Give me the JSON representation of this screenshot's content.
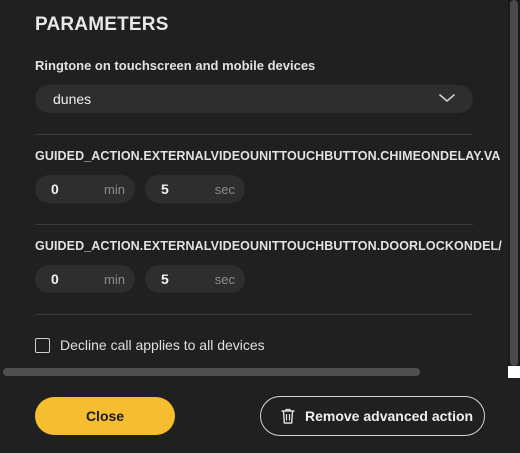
{
  "header": {
    "title": "PARAMETERS"
  },
  "ringtone": {
    "label": "Ringtone on touchscreen and mobile devices",
    "selected": "dunes"
  },
  "chime_delay": {
    "label": "GUIDED_ACTION.EXTERNALVIDEOUNITTOUCHBUTTON.CHIMEONDELAY.VA",
    "minutes": "0",
    "minutes_unit": "min",
    "seconds": "5",
    "seconds_unit": "sec"
  },
  "doorlock_delay": {
    "label": "GUIDED_ACTION.EXTERNALVIDEOUNITTOUCHBUTTON.DOORLOCKONDEL/",
    "minutes": "0",
    "minutes_unit": "min",
    "seconds": "5",
    "seconds_unit": "sec"
  },
  "decline_all": {
    "label": "Decline call applies to all devices",
    "checked": false
  },
  "footer": {
    "close_label": "Close",
    "remove_label": "Remove advanced action"
  },
  "icons": {
    "dropdown": "chevron-down-icon",
    "remove": "trash-icon"
  },
  "colors": {
    "background": "#202020",
    "accent": "#f5bd2f",
    "field": "#2e2e2e"
  }
}
